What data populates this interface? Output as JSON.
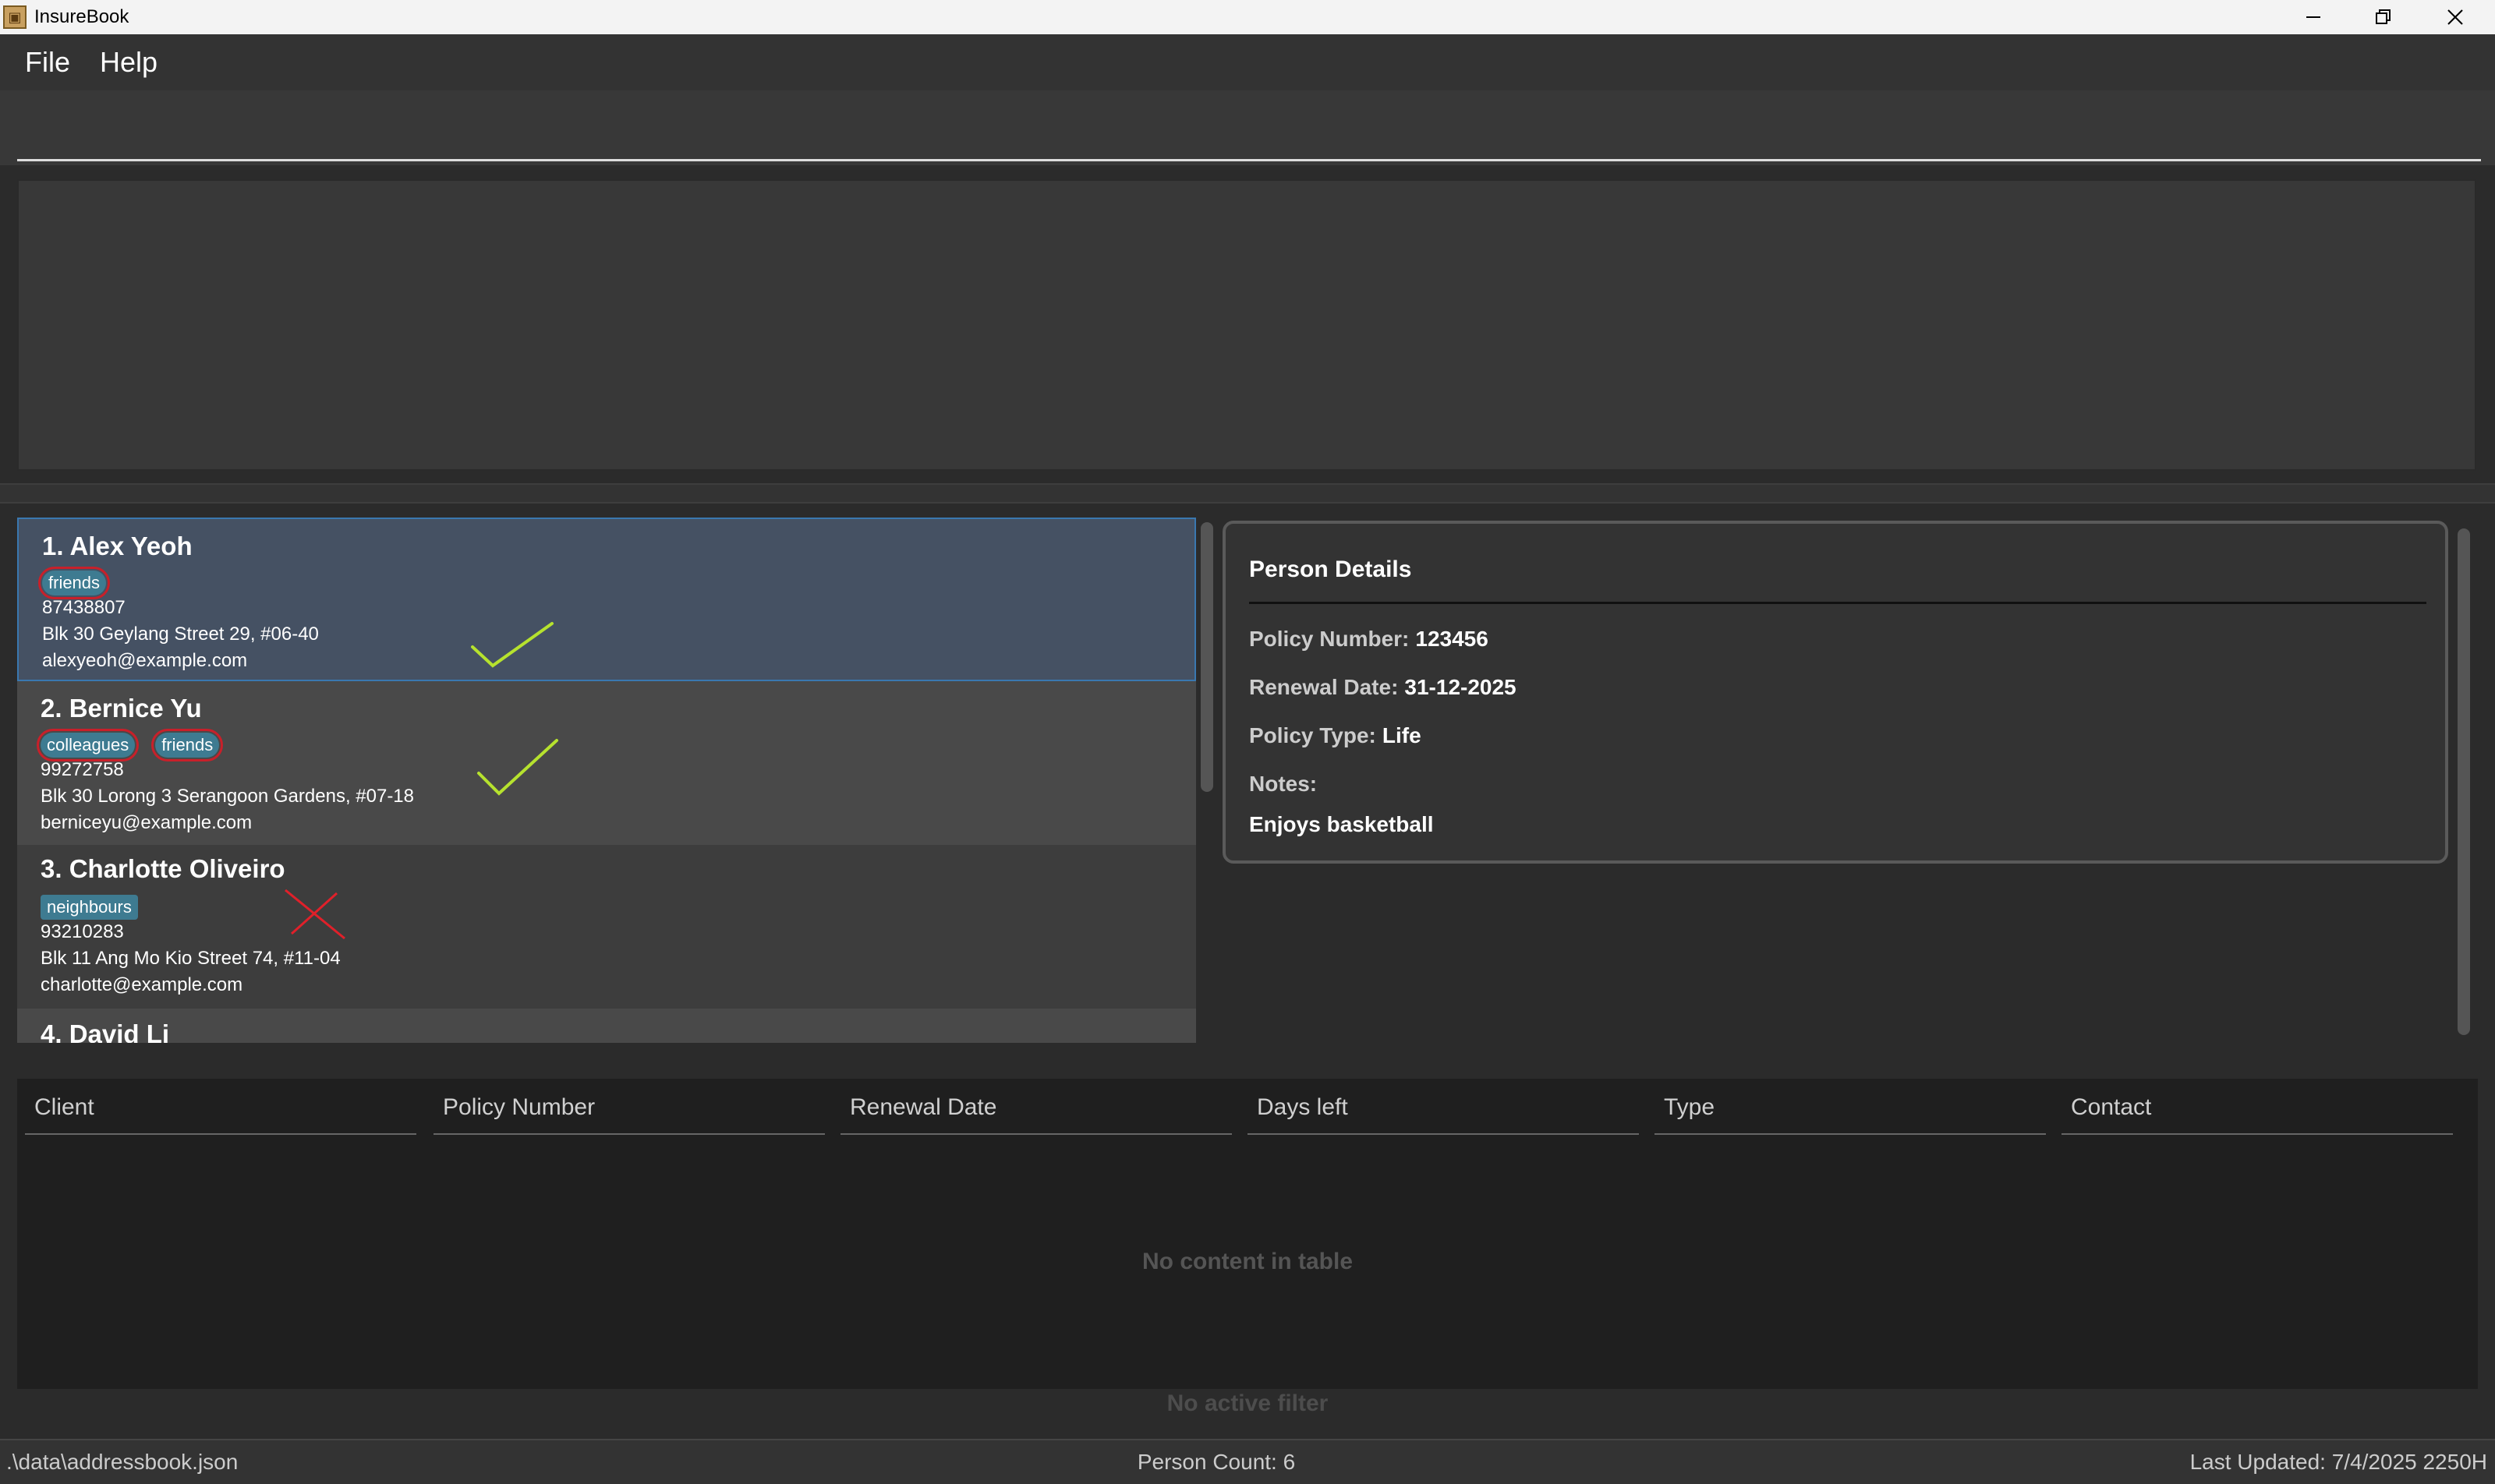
{
  "window": {
    "title": "InsureBook"
  },
  "menu": {
    "file": "File",
    "help": "Help"
  },
  "command": {
    "value": "",
    "placeholder": ""
  },
  "persons": [
    {
      "name": "1. Alex Yeoh",
      "tags": [
        "friends"
      ],
      "phone": "87438807",
      "address": "Blk 30 Geylang Street 29, #06-40",
      "email": "alexyeoh@example.com"
    },
    {
      "name": "2. Bernice Yu",
      "tags": [
        "colleagues",
        "friends"
      ],
      "phone": "99272758",
      "address": "Blk 30 Lorong 3 Serangoon Gardens, #07-18",
      "email": "berniceyu@example.com"
    },
    {
      "name": "3. Charlotte Oliveiro",
      "tags": [
        "neighbours"
      ],
      "phone": "93210283",
      "address": "Blk 11 Ang Mo Kio Street 74, #11-04",
      "email": "charlotte@example.com"
    },
    {
      "name": "4. David Li"
    }
  ],
  "details": {
    "title": "Person Details",
    "policy_number_label": "Policy Number:",
    "policy_number": "123456",
    "renewal_date_label": "Renewal Date:",
    "renewal_date": "31-12-2025",
    "policy_type_label": "Policy Type:",
    "policy_type": "Life",
    "notes_label": "Notes:",
    "notes": "Enjoys basketball"
  },
  "table": {
    "columns": [
      "Client",
      "Policy Number",
      "Renewal Date",
      "Days left",
      "Type",
      "Contact"
    ],
    "empty_text": "No content in table"
  },
  "filter_status": "No active filter",
  "status": {
    "file_path": ".\\data\\addressbook.json",
    "person_count": "Person Count: 6",
    "last_updated": "Last Updated: 7/4/2025 2250H"
  },
  "colors": {
    "tag": "#3e7b91",
    "selected_card": "#455163",
    "check_mark": "#b6e22e",
    "cross_mark": "#e0202a",
    "circle_mark": "#c8202a"
  }
}
